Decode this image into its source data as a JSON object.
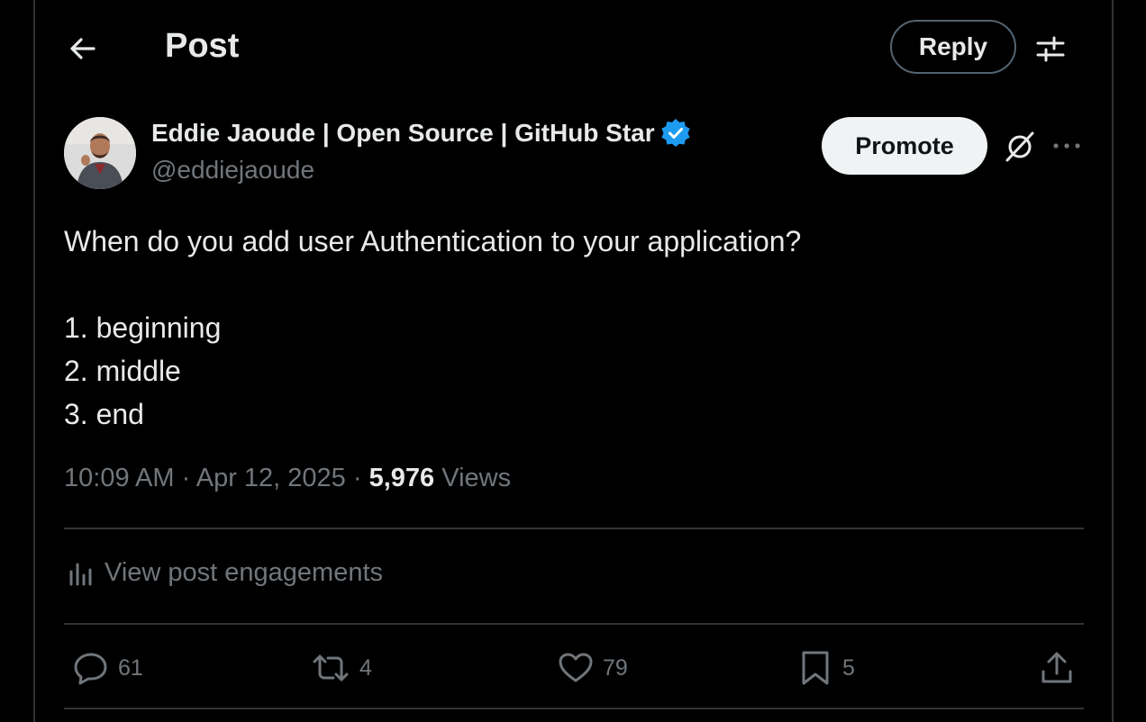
{
  "header": {
    "title": "Post",
    "reply_label": "Reply",
    "back_icon": "arrow-left-icon",
    "filter_icon": "sliders-icon"
  },
  "author": {
    "name": "Eddie Jaoude | Open Source | GitHub Star",
    "handle": "@eddiejaoude",
    "verified": true
  },
  "promote_label": "Promote",
  "post": {
    "lines": [
      "When do you add user Authentication to your application?",
      "",
      "1. beginning",
      "2. middle",
      "3. end"
    ],
    "time": "10:09 AM",
    "date": "Apr 12, 2025",
    "views_count": "5,976",
    "views_label": "Views",
    "separator": "·"
  },
  "engagements_label": "View post engagements",
  "actions": {
    "replies": "61",
    "reposts": "4",
    "likes": "79",
    "bookmarks": "5"
  },
  "colors": {
    "background": "#000000",
    "text": "#e7e9ea",
    "secondary": "#71767b",
    "verified": "#1d9bf0",
    "border": "#2f3336"
  }
}
